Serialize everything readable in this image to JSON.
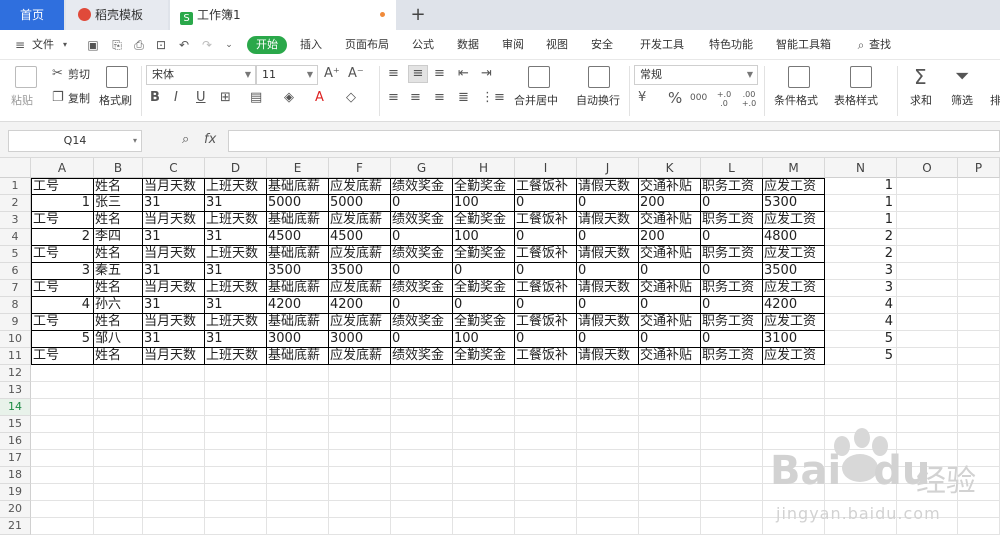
{
  "tabs": {
    "home": "首页",
    "doke": "稻壳模板",
    "book": "工作簿1",
    "book_icon": "S",
    "new_tab": "+"
  },
  "menu": {
    "file": "文件",
    "start": "开始",
    "items": [
      "插入",
      "页面布局",
      "公式",
      "数据",
      "审阅",
      "视图",
      "安全",
      "开发工具",
      "特色功能",
      "智能工具箱"
    ],
    "search": "查找"
  },
  "ribbon": {
    "paste": "粘贴",
    "cut": "剪切",
    "copy": "复制",
    "format_painter": "格式刷",
    "font_name": "宋体",
    "font_size": "11",
    "merge": "合并居中",
    "wrap": "自动换行",
    "number_format": "常规",
    "cond_format": "条件格式",
    "table_style": "表格样式",
    "sum": "求和",
    "filter": "筛选",
    "sort": "排",
    "bold": "B",
    "italic": "I",
    "underline": "U",
    "percent": "%",
    "thousands": "000",
    "inc_dec": "+.0 .0",
    "dec_dec": ".00 +.0"
  },
  "formula_bar": {
    "name_box": "Q14",
    "fx": "fx",
    "value": ""
  },
  "columns": [
    "A",
    "B",
    "C",
    "D",
    "E",
    "F",
    "G",
    "H",
    "I",
    "J",
    "K",
    "L",
    "M",
    "N",
    "O",
    "P"
  ],
  "rows": [
    [
      "工号",
      "姓名",
      "当月天数",
      "上班天数",
      "基础底薪",
      "应发底薪",
      "绩效奖金",
      "全勤奖金",
      "工餐饭补",
      "请假天数",
      "交通补贴",
      "职务工资",
      "应发工资",
      "1"
    ],
    [
      "1",
      "张三",
      "31",
      "31",
      "5000",
      "5000",
      "0",
      "100",
      "0",
      "0",
      "200",
      "0",
      "5300",
      "1"
    ],
    [
      "工号",
      "姓名",
      "当月天数",
      "上班天数",
      "基础底薪",
      "应发底薪",
      "绩效奖金",
      "全勤奖金",
      "工餐饭补",
      "请假天数",
      "交通补贴",
      "职务工资",
      "应发工资",
      "1"
    ],
    [
      "2",
      "李四",
      "31",
      "31",
      "4500",
      "4500",
      "0",
      "100",
      "0",
      "0",
      "200",
      "0",
      "4800",
      "2"
    ],
    [
      "工号",
      "姓名",
      "当月天数",
      "上班天数",
      "基础底薪",
      "应发底薪",
      "绩效奖金",
      "全勤奖金",
      "工餐饭补",
      "请假天数",
      "交通补贴",
      "职务工资",
      "应发工资",
      "2"
    ],
    [
      "3",
      "秦五",
      "31",
      "31",
      "3500",
      "3500",
      "0",
      "0",
      "0",
      "0",
      "0",
      "0",
      "3500",
      "3"
    ],
    [
      "工号",
      "姓名",
      "当月天数",
      "上班天数",
      "基础底薪",
      "应发底薪",
      "绩效奖金",
      "全勤奖金",
      "工餐饭补",
      "请假天数",
      "交通补贴",
      "职务工资",
      "应发工资",
      "3"
    ],
    [
      "4",
      "孙六",
      "31",
      "31",
      "4200",
      "4200",
      "0",
      "0",
      "0",
      "0",
      "0",
      "0",
      "4200",
      "4"
    ],
    [
      "工号",
      "姓名",
      "当月天数",
      "上班天数",
      "基础底薪",
      "应发底薪",
      "绩效奖金",
      "全勤奖金",
      "工餐饭补",
      "请假天数",
      "交通补贴",
      "职务工资",
      "应发工资",
      "4"
    ],
    [
      "5",
      "邹八",
      "31",
      "31",
      "3000",
      "3000",
      "0",
      "100",
      "0",
      "0",
      "0",
      "0",
      "3100",
      "5"
    ],
    [
      "工号",
      "姓名",
      "当月天数",
      "上班天数",
      "基础底薪",
      "应发底薪",
      "绩效奖金",
      "全勤奖金",
      "工餐饭补",
      "请假天数",
      "交通补贴",
      "职务工资",
      "应发工资",
      "5"
    ]
  ],
  "row_count": 21,
  "selected_row": 14,
  "watermark": {
    "brand": "Bai",
    "brand2": "du",
    "cn": "经验",
    "url": "jingyan.baidu.com"
  },
  "colors": {
    "accent": "#2f6fde",
    "start_green": "#2aa84a",
    "grid_select": "#1e8c45"
  }
}
